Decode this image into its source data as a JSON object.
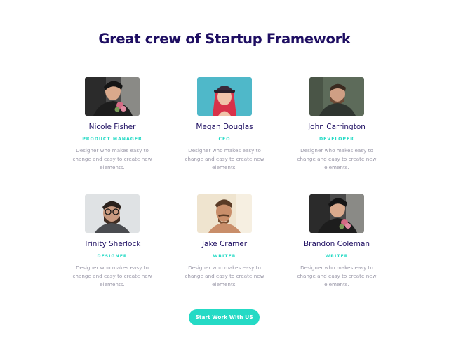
{
  "heading": "Great crew of Startup Framework",
  "team": [
    {
      "name": "Nicole Fisher",
      "role": "PRODUCT MANAGER",
      "description": "Designer who makes easy to change and easy to create new elements.",
      "photo_icon": "portrait-man-with-flowers"
    },
    {
      "name": "Megan Douglas",
      "role": "CEO",
      "description": "Designer who makes easy to change and easy to create new elements.",
      "photo_icon": "portrait-woman-red-hair-cap"
    },
    {
      "name": "John Carrington",
      "role": "DEVELOPER",
      "description": "Designer who makes easy to change and easy to create new elements.",
      "photo_icon": "portrait-man-beard"
    },
    {
      "name": "Trinity Sherlock",
      "role": "DESIGNER",
      "description": "Designer who makes easy to change and easy to create new elements.",
      "photo_icon": "portrait-man-glasses"
    },
    {
      "name": "Jake Cramer",
      "role": "WRITER",
      "description": "Designer who makes easy to change and easy to create new elements.",
      "photo_icon": "portrait-man-mustache"
    },
    {
      "name": "Brandon Coleman",
      "role": "WRITER",
      "description": "Designer who makes easy to change and easy to create new elements.",
      "photo_icon": "portrait-man-with-flowers"
    }
  ],
  "cta": {
    "label": "Start Work With US"
  },
  "colors": {
    "heading": "#1e0e62",
    "accent": "#25dac5",
    "muted": "#9a98a8"
  }
}
